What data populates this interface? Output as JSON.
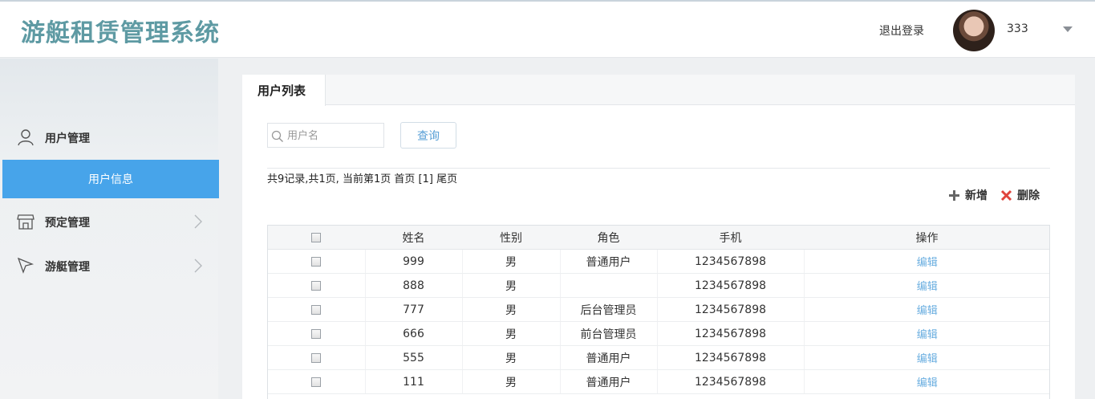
{
  "header": {
    "app_title": "游艇租赁管理系统",
    "logout": "退出登录",
    "username": "333"
  },
  "sidebar": {
    "groups": [
      {
        "label": "用户管理",
        "icon": "user-icon"
      },
      {
        "label": "预定管理",
        "icon": "store-icon"
      },
      {
        "label": "游艇管理",
        "icon": "cursor-icon"
      }
    ],
    "active_sub": "用户信息"
  },
  "content": {
    "tab": "用户列表",
    "search_placeholder": "用户名",
    "query_button": "查询",
    "pager": {
      "summary": "共9记录,共1页, 当前第1页",
      "first": "首页",
      "current": "[1]",
      "last": "尾页"
    },
    "add_label": "新增",
    "delete_label": "删除",
    "table": {
      "headers": [
        "姓名",
        "性别",
        "角色",
        "手机",
        "操作"
      ],
      "rows": [
        {
          "name": "999",
          "gender": "男",
          "role": "普通用户",
          "phone": "1234567898",
          "action": "编辑"
        },
        {
          "name": "888",
          "gender": "男",
          "role": "",
          "phone": "1234567898",
          "action": "编辑"
        },
        {
          "name": "777",
          "gender": "男",
          "role": "后台管理员",
          "phone": "1234567898",
          "action": "编辑"
        },
        {
          "name": "666",
          "gender": "男",
          "role": "前台管理员",
          "phone": "1234567898",
          "action": "编辑"
        },
        {
          "name": "555",
          "gender": "男",
          "role": "普通用户",
          "phone": "1234567898",
          "action": "编辑"
        },
        {
          "name": "111",
          "gender": "男",
          "role": "普通用户",
          "phone": "1234567898",
          "action": "编辑"
        }
      ]
    }
  },
  "colors": {
    "title": "#5e9aa3",
    "active_menu": "#47a4ea",
    "link": "#6aaee0",
    "delete": "#e0443c"
  }
}
